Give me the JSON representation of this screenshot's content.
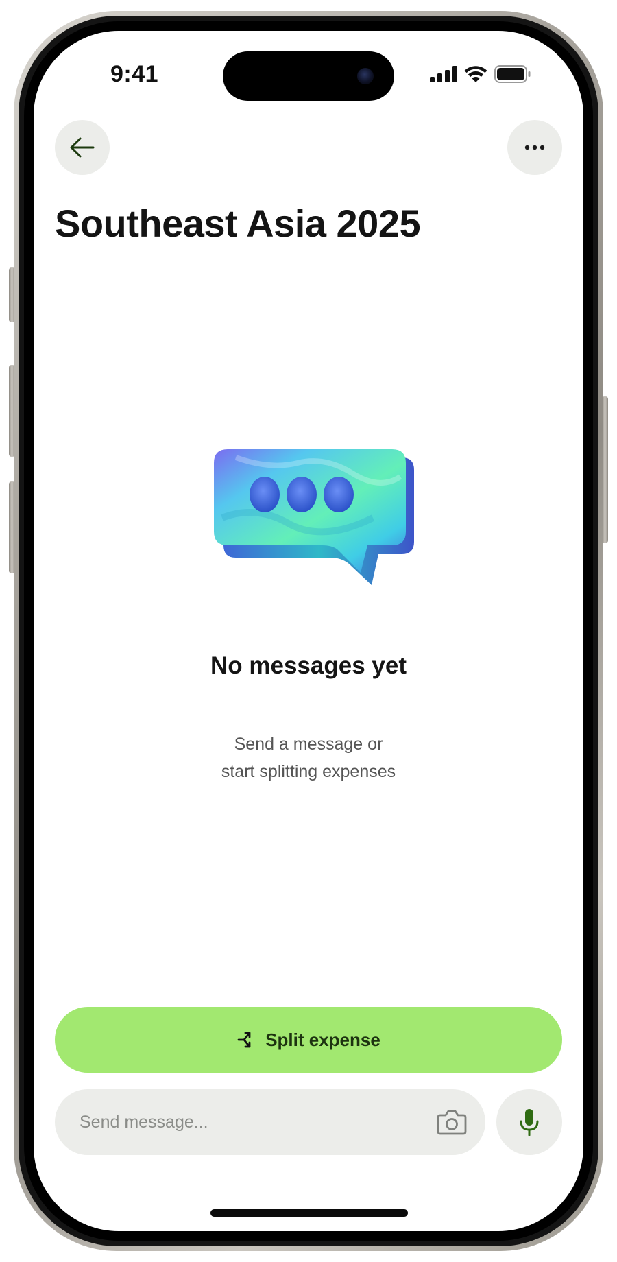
{
  "status_bar": {
    "time": "9:41"
  },
  "header": {
    "title": "Southeast Asia 2025",
    "back_icon": "arrow-left-icon",
    "more_icon": "ellipsis-icon"
  },
  "empty_state": {
    "illustration": "chat-bubble-illustration",
    "title": "No messages yet",
    "subtitle_line1": "Send a message or",
    "subtitle_line2": "start splitting expenses"
  },
  "actions": {
    "split_label": "Split expense",
    "split_icon": "split-icon"
  },
  "composer": {
    "placeholder": "Send message...",
    "value": "",
    "camera_icon": "camera-icon",
    "mic_icon": "microphone-icon"
  },
  "colors": {
    "accent": "#a2e870",
    "accent_text": "#1d3310",
    "icon_green": "#2f6b12",
    "control_bg": "#ecedea"
  }
}
